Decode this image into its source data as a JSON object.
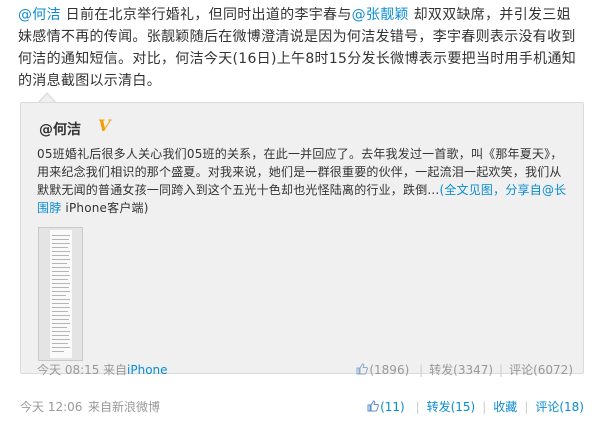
{
  "post": {
    "mention_1": "@何洁",
    "text_1": " 日前在北京举行婚礼，但同时出道的李宇春与",
    "mention_2": "@张靓颖",
    "text_2": " 却双双缺席，并引发三姐妹感情不再的传闻。张靓颖随后在微博澄清说是因为何洁发错号，李宇春则表示没有收到何洁的通知短信。对比，何洁今天(16日)上午8时15分发长微博表示要把当时用手机通知的消息截图以示清白。"
  },
  "quote": {
    "author": "@何洁",
    "verified_badge": "V",
    "text": "05班婚礼后很多人关心我们05班的关系，在此一并回应了。去年我发过一首歌，叫《那年夏天》，用来纪念我们相识的那个盛夏。对我来说，她们是一群很重要的伙伴，一起流泪一起欢笑，我们从默默无闻的普通女孩一同跨入到这个五光十色却也光怪陆离的行业，跌倒...",
    "full_text_link": "(全文见图，分享自",
    "via_mention": "@长围脖",
    "via_suffix": " iPhone客户端)",
    "time": "今天 08:15",
    "source_prefix": "来自",
    "source": "iPhone",
    "like_count": "(1896)",
    "repost_label": "转发(3347)",
    "comment_label": "评论(6072)"
  },
  "footer": {
    "time": "今天 12:06",
    "via": "来自新浪微博",
    "like_count": "(11)",
    "repost_label": "转发(15)",
    "favorite_label": "收藏",
    "comment_label": "评论(18)"
  },
  "colors": {
    "link": "#0a8cd2",
    "muted": "#999999",
    "quote_bg": "#f0f0f0",
    "badge": "#f0a000"
  },
  "icons": [
    "thumbs-up-icon",
    "verified-v-icon"
  ]
}
